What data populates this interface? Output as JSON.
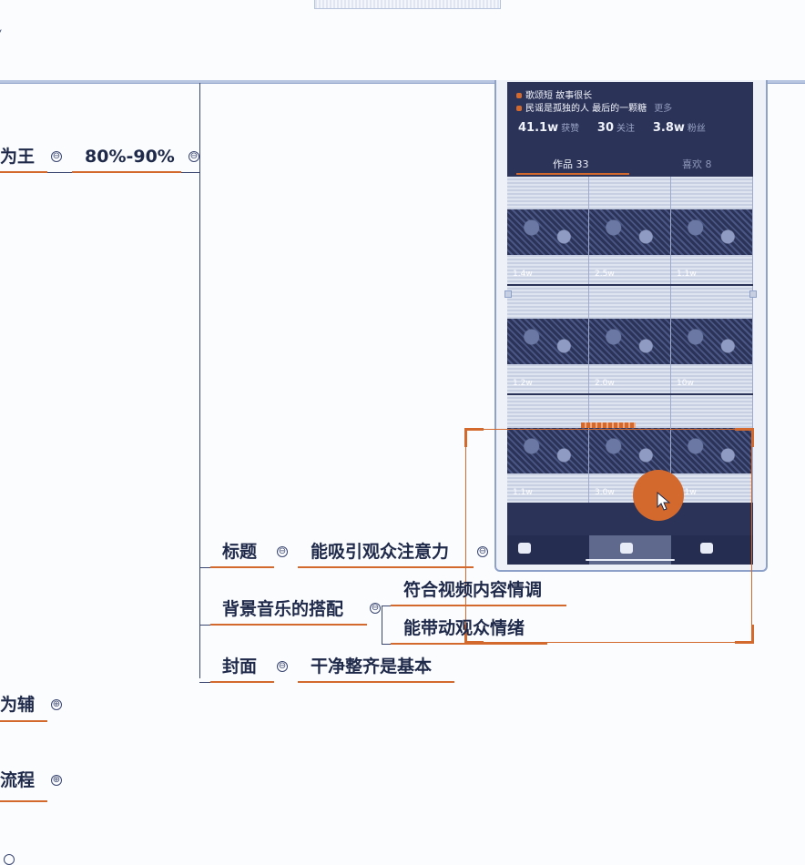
{
  "top_chevron": "˅",
  "mindmap": {
    "branch_1": {
      "label": "为王",
      "child": "80%-90%"
    },
    "title_node": {
      "label": "标题",
      "child": "能吸引观众注意力"
    },
    "music_node": {
      "label": "背景音乐的搭配",
      "child_1": "符合视频内容情调",
      "child_2": "能带动观众情绪"
    },
    "cover_node": {
      "label": "封面",
      "child": "干净整齐是基本"
    },
    "branch_2": {
      "label": "为辅"
    },
    "branch_3": {
      "label": "流程"
    }
  },
  "toggle_symbols": {
    "collapse": "⊖",
    "expand": "⊕"
  },
  "phone": {
    "bio_line_1": "歌颂短 故事很长",
    "bio_line_2": "民谣是孤独的人 最后的一颗糖",
    "bio_more": "更多",
    "stats": [
      {
        "value": "41.1w",
        "label": "获赞"
      },
      {
        "value": "30",
        "label": "关注"
      },
      {
        "value": "3.8w",
        "label": "粉丝"
      }
    ],
    "tab_works": "作品 33",
    "tab_likes": "喜欢 8",
    "videos": [
      {
        "views": "1.4w"
      },
      {
        "views": "2.5w"
      },
      {
        "views": "1.1w"
      },
      {
        "views": "1.2w"
      },
      {
        "views": "2.0w"
      },
      {
        "views": "10w"
      },
      {
        "views": "1.1w"
      },
      {
        "views": "3.0w"
      },
      {
        "views": "2.1w"
      }
    ]
  },
  "colors": {
    "accent": "#d4692e",
    "text": "#1f2a4a",
    "phone_bg": "#2b3358",
    "rule": "#b9c6e2"
  }
}
